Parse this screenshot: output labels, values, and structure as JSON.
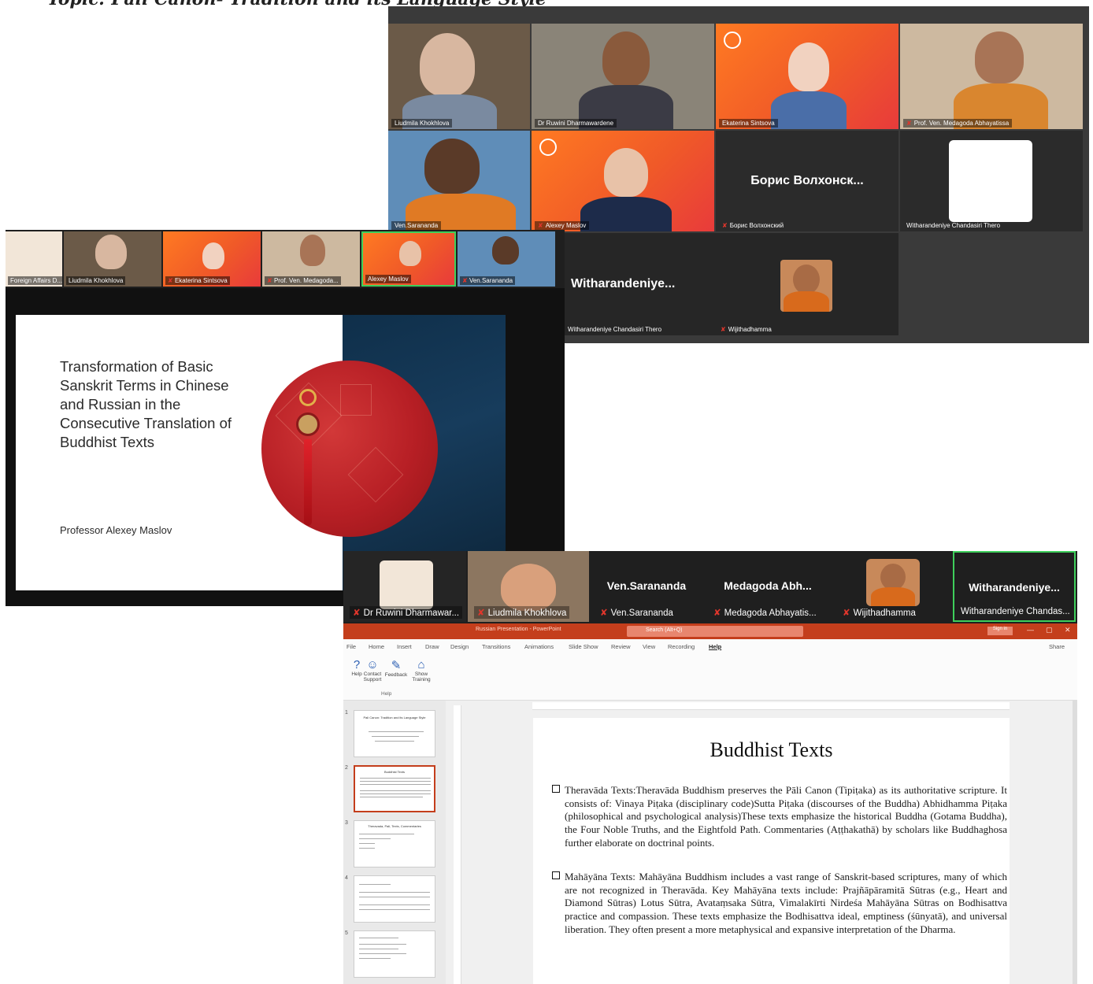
{
  "page_title": "Topic: Pali Canon- Tradition and its Language Style",
  "gallery": {
    "tiles": [
      {
        "name": "Liudmila Khokhlova"
      },
      {
        "name": "Dr Ruwini Dharmawardene"
      },
      {
        "name": "Ekaterina Sintsova"
      },
      {
        "name": "Prof. Ven. Medagoda Abhayatissa"
      },
      {
        "name": "Ven.Sarananda"
      },
      {
        "name": "Alexey Maslov"
      },
      {
        "name": "Борис Волхонский",
        "big": "Борис Волхонск..."
      },
      {
        "name": "Witharandeniye Chandasiri Thero"
      },
      {
        "name": "Witharandeniye Chandasiri Thero",
        "big": "Witharandeniye..."
      },
      {
        "name": "Wijithadhamma"
      }
    ]
  },
  "share": {
    "strip": [
      {
        "name": "Foreign Affairs D..."
      },
      {
        "name": "Liudmila Khokhlova"
      },
      {
        "name": "Ekaterina Sintsova"
      },
      {
        "name": "Prof. Ven. Medagoda..."
      },
      {
        "name": "Alexey Maslov"
      },
      {
        "name": "Ven.Sarananda"
      }
    ],
    "slide": {
      "title": "Transformation of Basic Sanskrit Terms in Chinese and Russian in the Consecutive Translation of Buddhist Texts",
      "author": "Professor Alexey Maslov"
    }
  },
  "ppt": {
    "strip": [
      {
        "name": "Dr Ruwini Dharmawar..."
      },
      {
        "name": "Liudmila Khokhlova"
      },
      {
        "name": "Ven.Sarananda",
        "big": "Ven.Sarananda"
      },
      {
        "name": "Medagoda Abhayatis...",
        "big": "Medagoda Abh..."
      },
      {
        "name": "Wijithadhamma"
      },
      {
        "name": "Witharandeniye Chandas...",
        "big": "Witharandeniye..."
      }
    ],
    "window_title": "Russian Presentation - PowerPoint",
    "search_placeholder": "Search (Alt+Q)",
    "sign_in": "Sign in",
    "menu": [
      "File",
      "Home",
      "Insert",
      "Draw",
      "Design",
      "Transitions",
      "Animations",
      "Slide Show",
      "Review",
      "View",
      "Recording",
      "Help"
    ],
    "share_label": "Share",
    "ribbon": {
      "buttons": [
        {
          "label": "Help",
          "icon": "help-icon"
        },
        {
          "label": "Contact Support",
          "icon": "contact-support-icon"
        },
        {
          "label": "Feedback",
          "icon": "feedback-icon"
        },
        {
          "label": "Show Training",
          "icon": "training-icon"
        }
      ],
      "group": "Help"
    },
    "thumbs": [
      {
        "num": "1",
        "title": "Pali Canon: Tradition and its Language Style"
      },
      {
        "num": "2",
        "title": "Buddhist Texts"
      },
      {
        "num": "3",
        "title": "Theravada, Pali, Texts, Commentaries"
      },
      {
        "num": "4",
        "title": ""
      },
      {
        "num": "5",
        "title": ""
      }
    ],
    "slide": {
      "heading": "Buddhist Texts",
      "para1": "Theravāda Texts:Theravāda Buddhism preserves the Pāli Canon (Tipiṭaka) as its authoritative scripture. It consists of: Vinaya Piṭaka (disciplinary code)Sutta Piṭaka (discourses of the Buddha) Abhidhamma Piṭaka (philosophical and psychological analysis)These texts emphasize the historical Buddha (Gotama Buddha), the Four Noble Truths, and the Eightfold Path. Commentaries (Aṭṭhakathā) by scholars like Buddhaghosa further elaborate on doctrinal points.",
      "para2": "Mahāyāna Texts: Mahāyāna Buddhism includes a vast range of Sanskrit-based scriptures, many of which are not recognized in Theravāda. Key Mahāyāna texts include: Prajñāpāramitā Sūtras (e.g., Heart and Diamond Sūtras) Lotus Sūtra, Avataṃsaka Sūtra, Vimalakīrti Nirdeśa Mahāyāna Sūtras on Bodhisattva practice and compassion. These texts emphasize the Bodhisattva ideal, emptiness (śūnyatā), and universal liberation. They often present a more metaphysical and expansive interpretation of the Dharma."
    }
  },
  "colors": {
    "ppt_accent": "#c43e1c",
    "zoom_active": "#3ecf5b",
    "avatar_orange": "#f05a28"
  }
}
